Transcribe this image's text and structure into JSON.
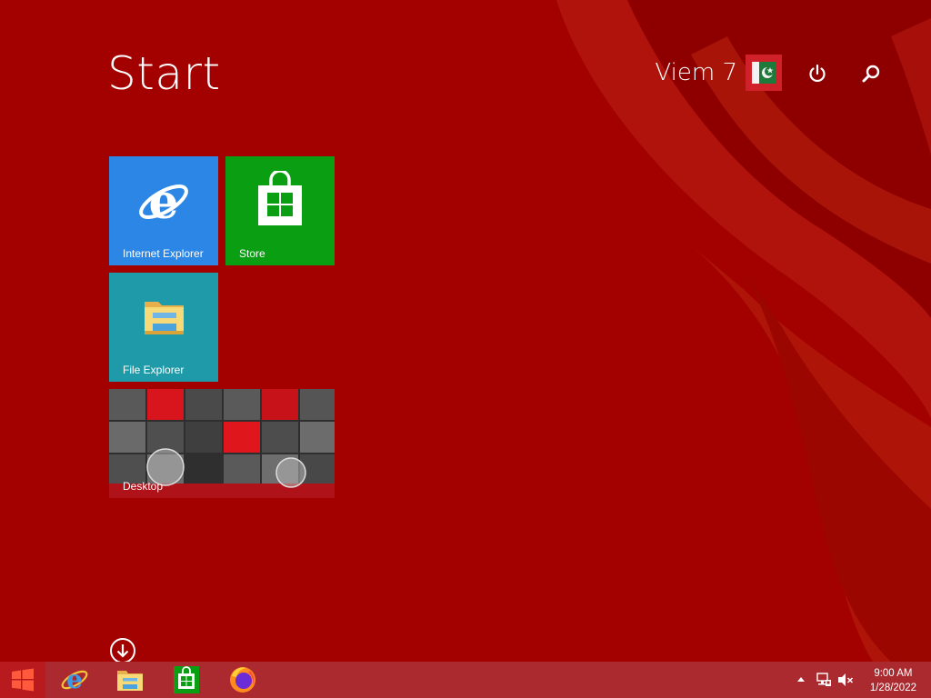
{
  "screen": {
    "title": "Start",
    "user": {
      "name": "Viem 7"
    }
  },
  "tiles": {
    "internet_explorer": {
      "label": "Internet Explorer",
      "color": "#2c86e6"
    },
    "store": {
      "label": "Store",
      "color": "#0a9e12"
    },
    "file_explorer": {
      "label": "File Explorer",
      "color": "#1e9aa8"
    },
    "desktop": {
      "label": "Desktop"
    }
  },
  "taskbar": {
    "pinned": [
      "internet-explorer",
      "file-explorer",
      "store",
      "firefox"
    ],
    "clock": {
      "time": "9:00 AM",
      "date": "1/28/2022"
    }
  },
  "colors": {
    "background": "#a30000",
    "taskbar": "#aa2a2f"
  }
}
